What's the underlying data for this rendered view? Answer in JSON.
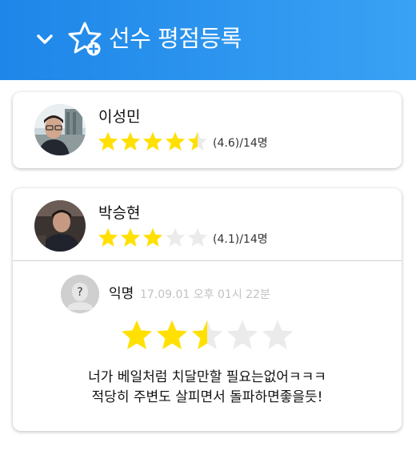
{
  "header": {
    "title": "선수 평점등록",
    "chevron_icon": "chevron-down-icon",
    "star_icon": "star-plus-icon",
    "colors": {
      "start": "#1d86e8",
      "end": "#3aa2f4"
    }
  },
  "players": [
    {
      "name": "이성민",
      "rating_value": 4.6,
      "stars_filled": 4.5,
      "rating_text": "(4.6)/14명"
    },
    {
      "name": "박승현",
      "rating_value": 4.1,
      "stars_filled": 3,
      "rating_text": "(4.1)/14명"
    }
  ],
  "review": {
    "author": "익명",
    "time": "17.09.01 오후 01시 22분",
    "stars_filled": 2.5,
    "comment_lines": [
      "너가 베일처럼 치달만할 필요는없어ㅋㅋㅋ",
      "적당히 주변도 살피면서 돌파하면좋을듯!"
    ]
  },
  "colors": {
    "star_on": "#ffe000",
    "star_off": "#ebebeb"
  }
}
